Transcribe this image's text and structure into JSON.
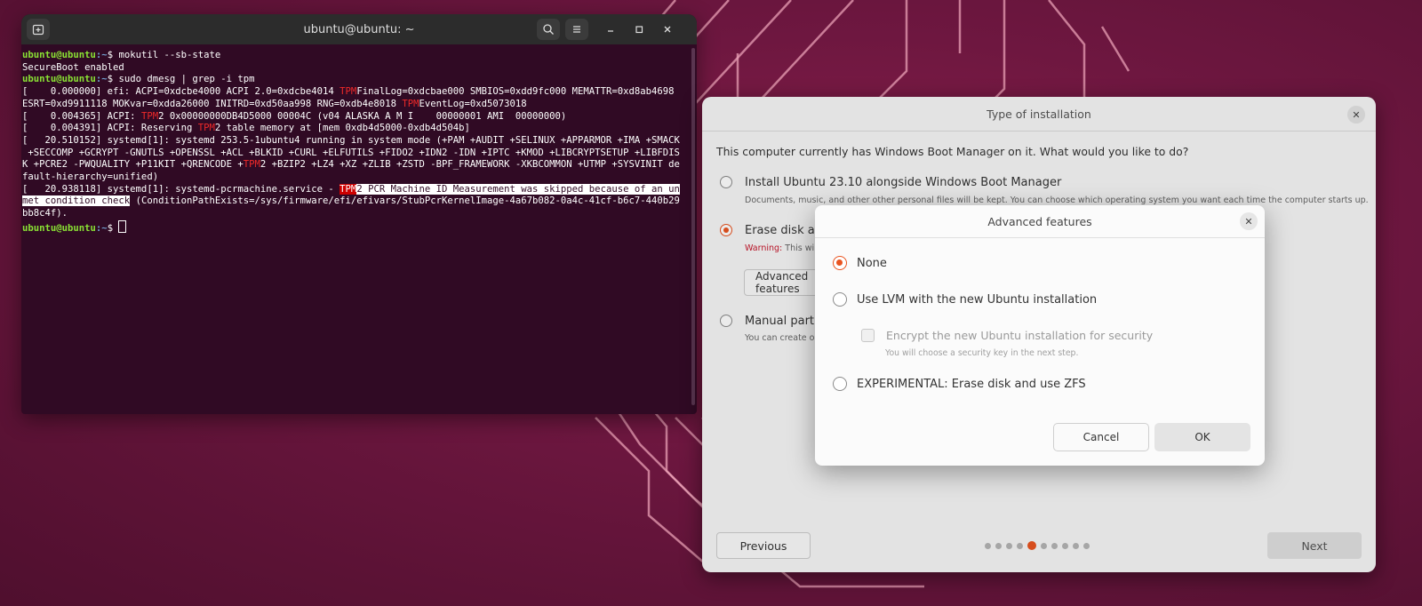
{
  "terminal": {
    "title": "ubuntu@ubuntu: ~",
    "prompt_user": "ubuntu@ubuntu",
    "prompt_path": ":~",
    "prompt_sign": "$ ",
    "cmd1": "mokutil --sb-state",
    "out1": "SecureBoot enabled",
    "cmd2": "sudo dmesg | grep -i tpm",
    "tpm": "TPM",
    "l1a": "[    0.000000] efi: ACPI=0xdcbe4000 ACPI 2.0=0xdcbe4014 ",
    "l1b": "FinalLog=0xdcbae000 SMBIOS=0xdd9fc000 MEMATTR=0xd8ab4698",
    "l2": "ESRT=0xd9911118 MOKvar=0xdda26000 INITRD=0xd50aa998 RNG=0xdb4e8018 ",
    "l2b": "EventLog=0xd5073018",
    "l3a": "[    0.004365] ACPI: ",
    "l3b": "2 0x00000000DB4D5000 00004C (v04 ALASKA A M I    00000001 AMI  00000000)",
    "l4a": "[    0.004391] ACPI: Reserving ",
    "l4b": "2 table memory at [mem 0xdb4d5000-0xdb4d504b]",
    "l5": "[   20.510152] systemd[1]: systemd 253.5-1ubuntu4 running in system mode (+PAM +AUDIT +SELINUX +APPARMOR +IMA +SMACK",
    "l6": " +SECCOMP +GCRYPT -GNUTLS +OPENSSL +ACL +BLKID +CURL +ELFUTILS +FIDO2 +IDN2 -IDN +IPTC +KMOD +LIBCRYPTSETUP +LIBFDIS",
    "l7a": "K +PCRE2 -PWQUALITY +P11KIT +QRENCODE +",
    "l7b": "2 +BZIP2 +LZ4 +XZ +ZLIB +ZSTD -BPF_FRAMEWORK -XKBCOMMON +UTMP +SYSVINIT de",
    "l8": "fault-hierarchy=unified)",
    "l9a": "[   20.938118] systemd[1]: systemd-pcrmachine.service - ",
    "l9b": "2 PCR Machine ID Measurement was skipped because of an un",
    "l10a": "met condition check",
    "l10b": " (ConditionPathExists=/sys/firmware/efi/efivars/StubPcrKernelImage-4a67b082-0a4c-41cf-b6c7-440b29",
    "l11": "bb8c4f)."
  },
  "installer": {
    "title": "Type of installation",
    "question": "This computer currently has Windows Boot Manager on it. What would you like to do?",
    "opt1_label": "Install Ubuntu 23.10 alongside Windows Boot Manager",
    "opt1_sub": "Documents, music, and other other personal files will be kept. You can choose which operating system you want each time the computer starts up.",
    "opt2_label": "Erase disk and",
    "opt2_warn": "Warning:",
    "opt2_sub": " This will",
    "advanced_label": "Advanced features",
    "opt3_label": "Manual partit",
    "opt3_sub": "You can create or",
    "previous": "Previous",
    "next": "Next",
    "steps_total": 10,
    "steps_active": 5
  },
  "dialog": {
    "title": "Advanced features",
    "opt_none": "None",
    "opt_lvm": "Use LVM with the new Ubuntu installation",
    "chk_encrypt": "Encrypt the new Ubuntu installation for security",
    "chk_encrypt_sub": "You will choose a security key in the next step.",
    "opt_zfs": "EXPERIMENTAL: Erase disk and use ZFS",
    "cancel": "Cancel",
    "ok": "OK",
    "selected": "none"
  },
  "colors": {
    "accent": "#e95420",
    "terminal_bg": "#300a24",
    "prompt_user": "#8ae234",
    "prompt_path": "#729fcf",
    "tpm_highlight": "#ef2929"
  }
}
